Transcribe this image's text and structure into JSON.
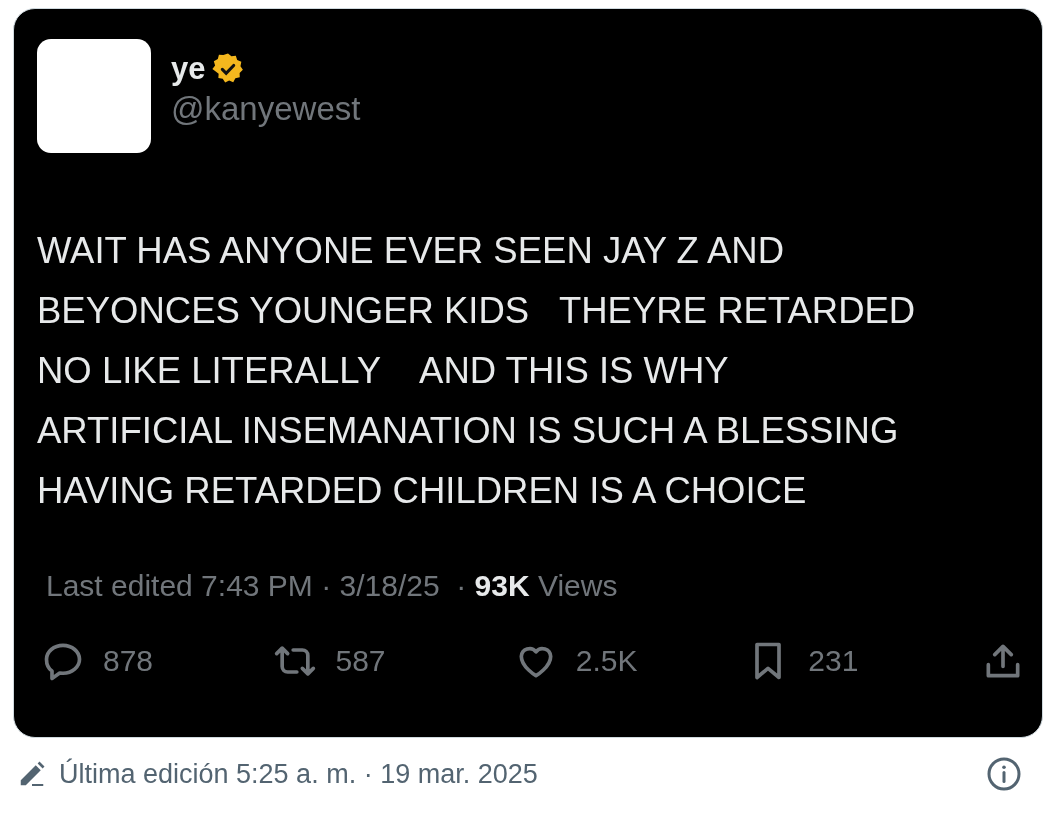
{
  "tweet": {
    "name": "ye",
    "verified": true,
    "handle": "@kanyewest",
    "body_lines": [
      "WAIT HAS ANYONE EVER SEEN JAY Z AND",
      "BEYONCES YOUNGER KIDS   THEYRE RETARDED",
      "NO LIKE LITERALLY    AND THIS IS WHY",
      "ARTIFICIAL INSEMANATION IS SUCH A BLESSING",
      "HAVING RETARDED CHILDREN IS A CHOICE"
    ],
    "meta": "Last edited 7:43 PM · 3/18/25  · **93K** Views",
    "actions": [
      {
        "kind": "reply",
        "count": "878"
      },
      {
        "kind": "repost",
        "count": "587"
      },
      {
        "kind": "like",
        "count": "2.5K"
      },
      {
        "kind": "bookmark",
        "count": "231"
      },
      {
        "kind": "share"
      }
    ]
  },
  "footer": {
    "edited": "Última edición 5:25 a. m. · 19 mar. 2025"
  }
}
